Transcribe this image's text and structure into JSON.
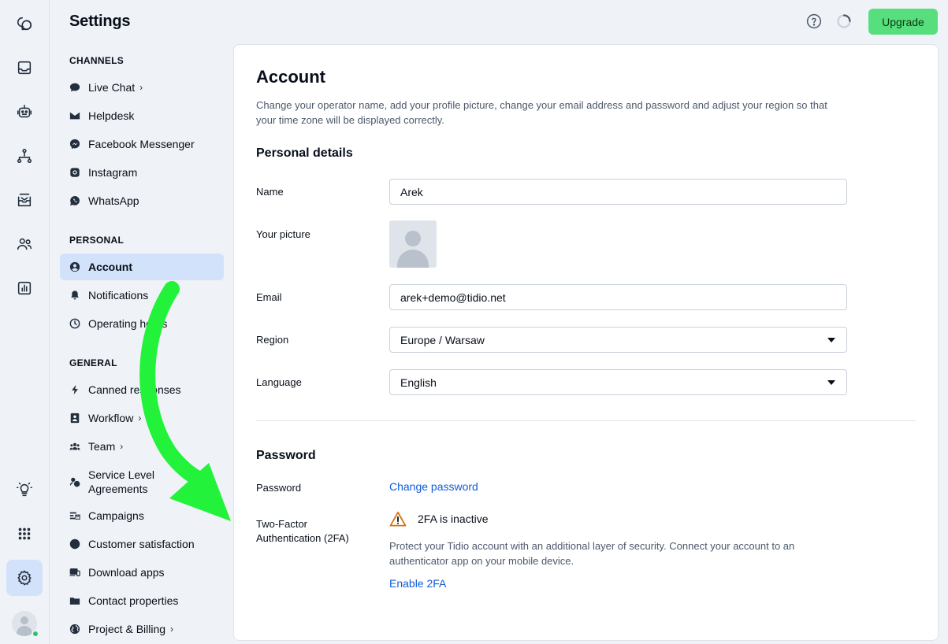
{
  "header": {
    "title": "Settings",
    "upgrade_label": "Upgrade"
  },
  "rail": {
    "items": [
      "chats-icon",
      "inbox-icon",
      "bot-icon",
      "flows-icon",
      "mail-icon",
      "contacts-icon",
      "analytics-icon"
    ],
    "bottom": [
      "lightbulb-icon",
      "apps-grid-icon",
      "settings-gear-icon"
    ]
  },
  "nav": {
    "channels_heading": "CHANNELS",
    "channels": [
      {
        "label": "Live Chat",
        "icon": "speech-bubble-icon"
      },
      {
        "label": "Helpdesk",
        "icon": "envelope-icon"
      },
      {
        "label": "Facebook Messenger",
        "icon": "messenger-icon"
      },
      {
        "label": "Instagram",
        "icon": "instagram-icon"
      },
      {
        "label": "WhatsApp",
        "icon": "whatsapp-icon"
      }
    ],
    "personal_heading": "PERSONAL",
    "personal": [
      {
        "label": "Account",
        "icon": "user-circle-icon"
      },
      {
        "label": "Notifications",
        "icon": "bell-icon"
      },
      {
        "label": "Operating hours",
        "icon": "clock-icon"
      }
    ],
    "general_heading": "GENERAL",
    "general": [
      {
        "label": "Canned responses",
        "icon": "lightning-icon"
      },
      {
        "label": "Workflow",
        "icon": "workflow-icon"
      },
      {
        "label": "Team",
        "icon": "team-icon"
      },
      {
        "label": "Service Level Agreements",
        "icon": "sla-icon"
      },
      {
        "label": "Campaigns",
        "icon": "campaigns-icon"
      },
      {
        "label": "Customer satisfaction",
        "icon": "smiley-icon"
      },
      {
        "label": "Download apps",
        "icon": "devices-icon"
      },
      {
        "label": "Contact properties",
        "icon": "folder-icon"
      },
      {
        "label": "Project & Billing",
        "icon": "globe-icon"
      }
    ]
  },
  "account": {
    "title": "Account",
    "description": "Change your operator name, add your profile picture, change your email address and password and adjust your region so that your time zone will be displayed correctly.",
    "personal_heading": "Personal details",
    "name_label": "Name",
    "name_value": "Arek",
    "picture_label": "Your picture",
    "email_label": "Email",
    "email_value": "arek+demo@tidio.net",
    "region_label": "Region",
    "region_value": "Europe / Warsaw",
    "language_label": "Language",
    "language_value": "English",
    "password_heading": "Password",
    "password_label": "Password",
    "change_password": "Change password",
    "twofa_label": "Two-Factor Authentication (2FA)",
    "twofa_status": "2FA is inactive",
    "twofa_description": "Protect your Tidio account with an additional layer of security. Connect your account to an authenticator app on your mobile device.",
    "enable_twofa": "Enable 2FA"
  },
  "colors": {
    "accent": "#0f5bd7",
    "upgrade": "#57df7e",
    "active_nav": "#d3e2fb",
    "warning": "#d9730d",
    "annotation_arrow": "#22f23a"
  }
}
